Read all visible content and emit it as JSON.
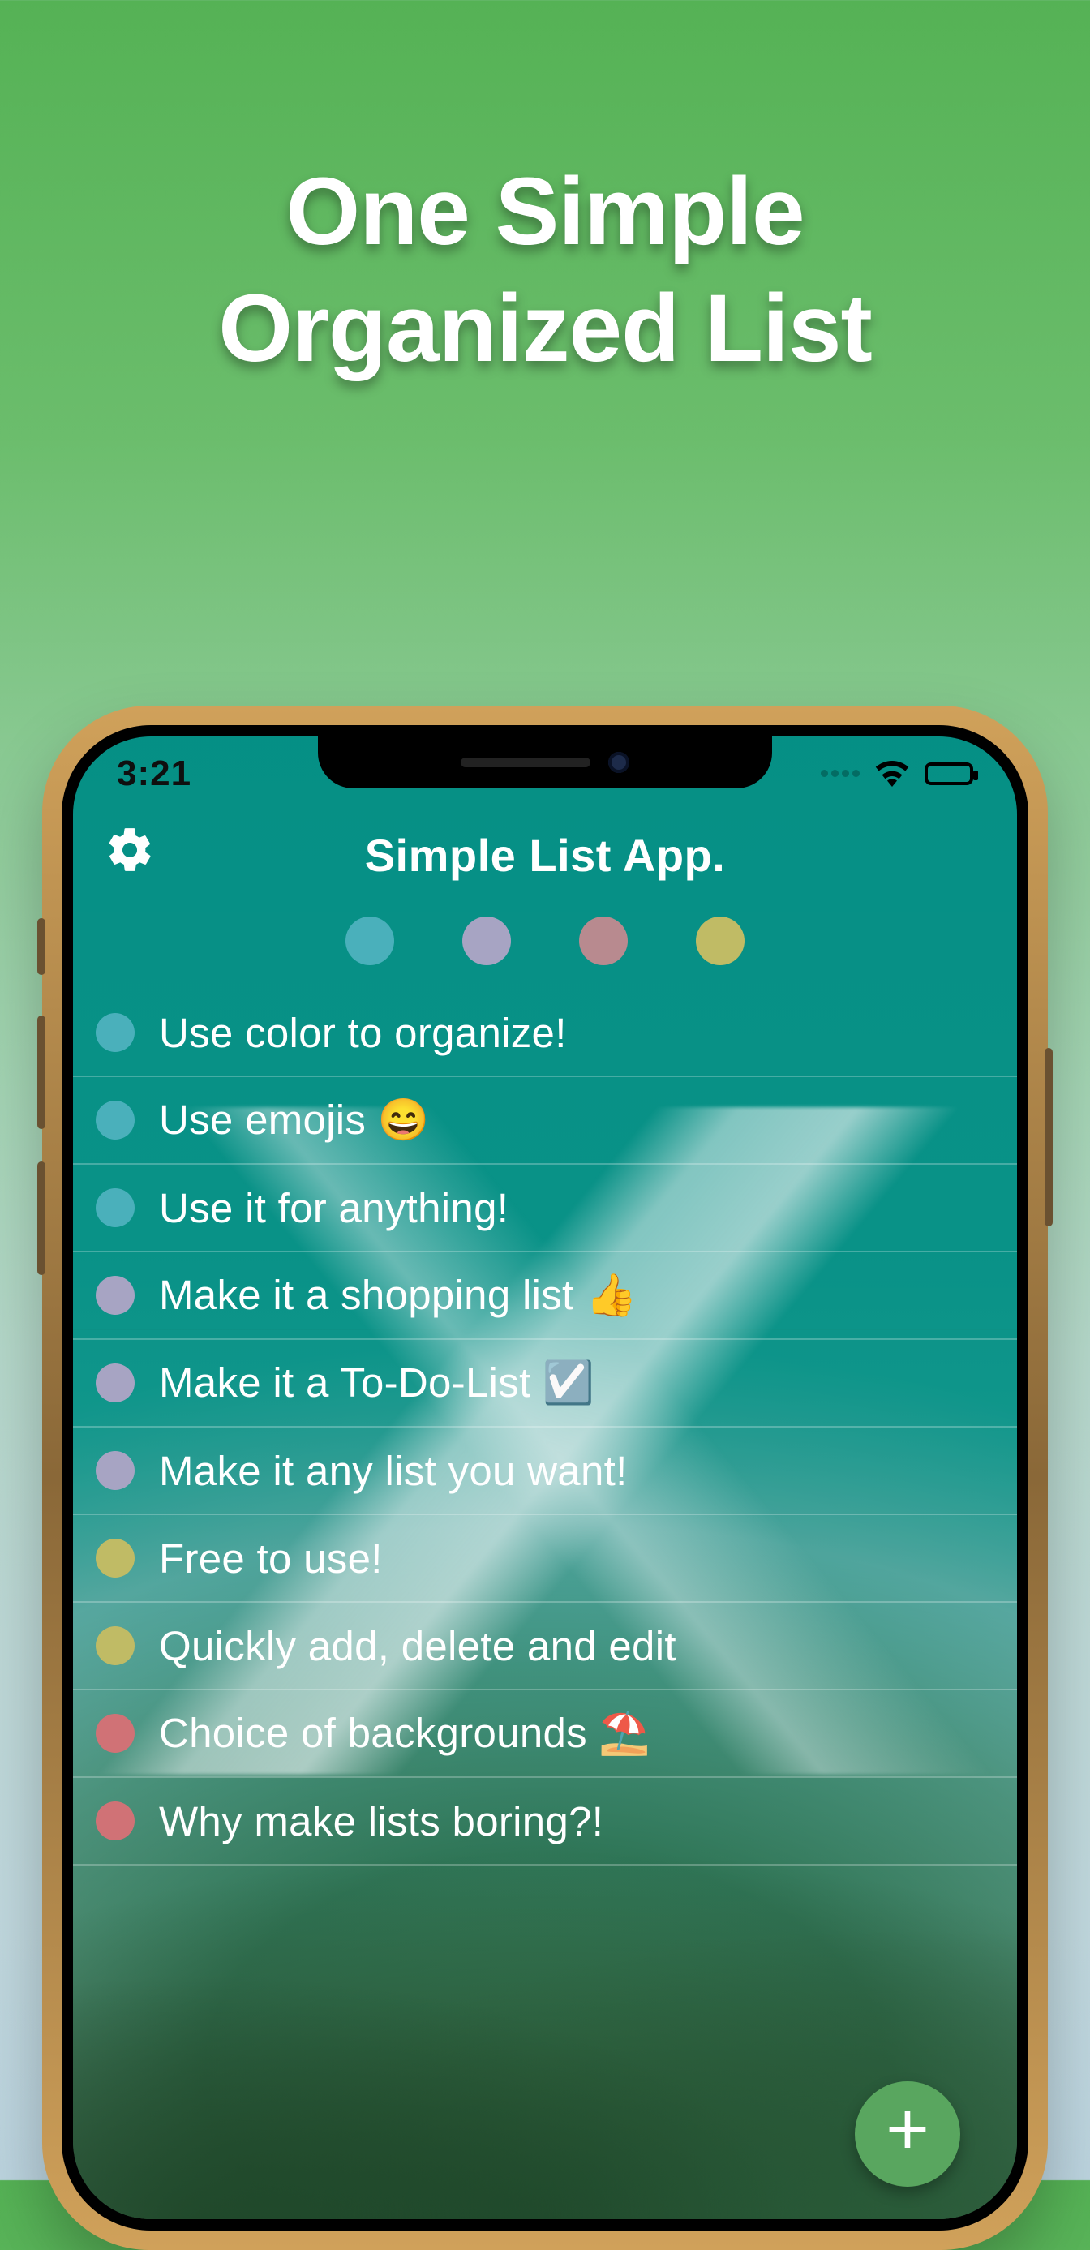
{
  "promo": {
    "line1": "One Simple",
    "line2": "Organized List"
  },
  "status": {
    "time": "3:21"
  },
  "header": {
    "title": "Simple List App."
  },
  "filter_colors": [
    "teal",
    "lav",
    "mauve",
    "olive"
  ],
  "list": [
    {
      "color": "teal",
      "text": "Use color to organize!"
    },
    {
      "color": "teal",
      "text": "Use emojis 😄"
    },
    {
      "color": "teal",
      "text": "Use it for anything!"
    },
    {
      "color": "lav",
      "text": "Make it a shopping list 👍"
    },
    {
      "color": "lav",
      "text": "Make it a To-Do-List ☑️"
    },
    {
      "color": "lav",
      "text": "Make it any list you want!"
    },
    {
      "color": "olive",
      "text": "Free to use!"
    },
    {
      "color": "olive",
      "text": "Quickly add, delete and edit"
    },
    {
      "color": "coral",
      "text": "Choice of backgrounds ⛱️"
    },
    {
      "color": "coral",
      "text": "Why make lists boring?!"
    }
  ],
  "colors": {
    "teal": "#4ab0bb",
    "lav": "#a7a4c3",
    "mauve": "#b88a8f",
    "olive": "#c0bb65",
    "coral": "#d07276"
  }
}
